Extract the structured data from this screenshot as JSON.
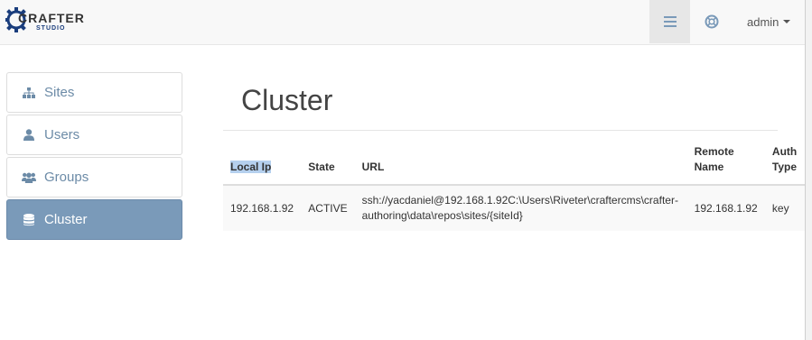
{
  "header": {
    "logo_text": "CRAFTER",
    "logo_sub": "STUDIO",
    "menu_icon": "hamburger-icon",
    "help_icon": "lifebuoy-icon",
    "user_label": "admin"
  },
  "sidebar": {
    "items": [
      {
        "label": "Sites",
        "icon": "sitemap-icon"
      },
      {
        "label": "Users",
        "icon": "user-icon"
      },
      {
        "label": "Groups",
        "icon": "users-icon"
      },
      {
        "label": "Cluster",
        "icon": "database-icon",
        "active": true
      }
    ]
  },
  "main": {
    "title": "Cluster",
    "table": {
      "headers": [
        "Local Ip",
        "State",
        "URL",
        "Remote Name",
        "Auth Type"
      ],
      "header_lines": {
        "remote": [
          "Remote",
          "Name"
        ],
        "auth": [
          "Auth",
          "Type"
        ]
      },
      "rows": [
        {
          "local_ip": "192.168.1.92",
          "state": "ACTIVE",
          "url_line1": "ssh://yacdaniel@192.168.1.92C:\\Users\\Riveter\\craftercms\\crafter-",
          "url_line2": "authoring\\data\\repos\\sites/{siteId}",
          "remote_name": "192.168.1.92",
          "auth_type": "key"
        }
      ]
    }
  },
  "colors": {
    "accent": "#7a9ab9",
    "sidebar_text": "#6c8ba7",
    "selection": "#b5d0ee"
  }
}
